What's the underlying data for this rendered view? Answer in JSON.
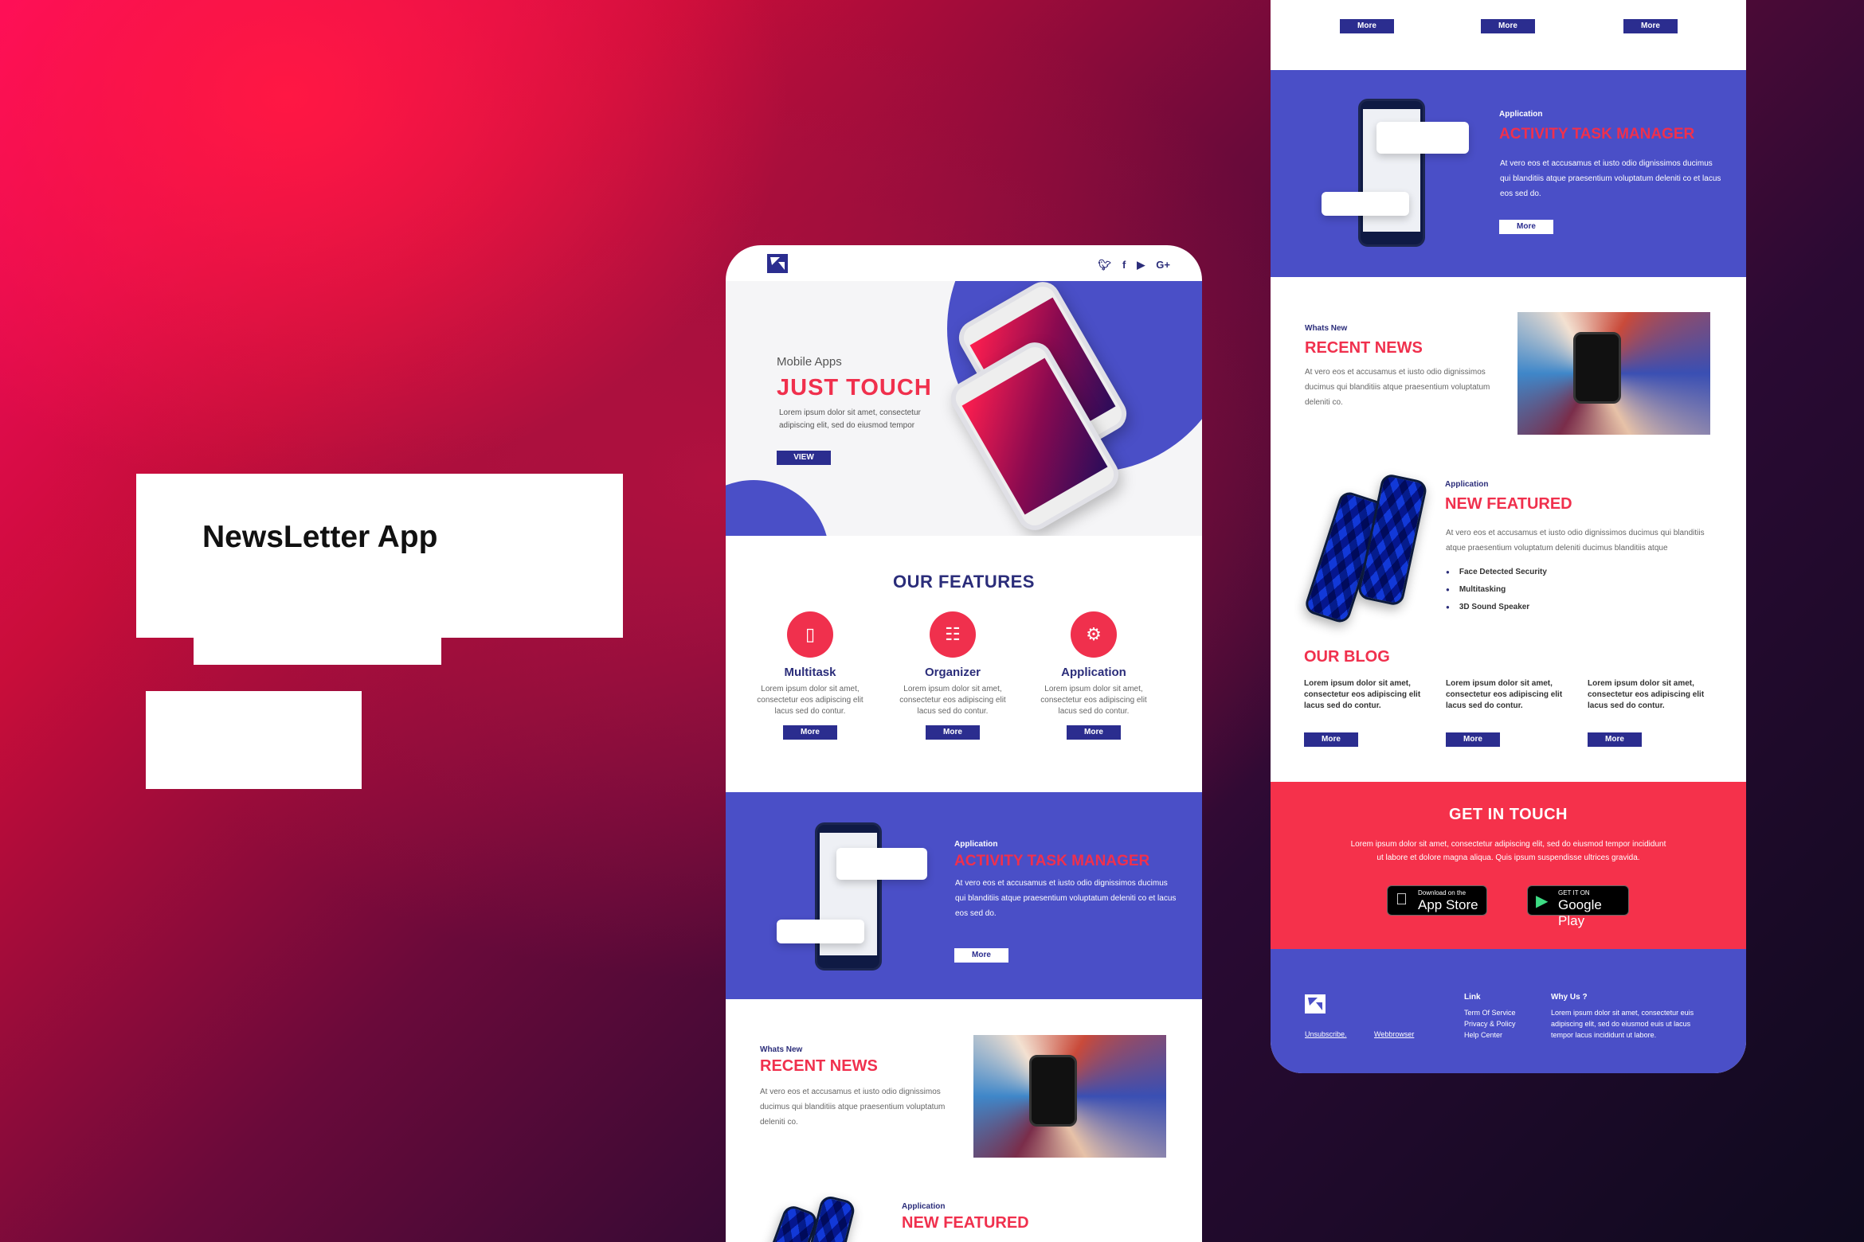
{
  "title_card": {
    "title": "NewsLetter App"
  },
  "phone": {
    "socials": [
      "y",
      "f",
      "▶",
      "G+"
    ],
    "hero": {
      "kicker": "Mobile Apps",
      "title": "JUST TOUCH",
      "text": "Lorem ipsum dolor sit amet, consectetur adipiscing elit, sed do eiusmod tempor",
      "button": "VIEW"
    },
    "features": {
      "title": "OUR FEATURES",
      "items": [
        {
          "icon": "phone-icon",
          "glyph": "▯",
          "title": "Multitask",
          "text": "Lorem ipsum dolor sit amet, consectetur eos adipiscing elit lacus sed do contur.",
          "button": "More"
        },
        {
          "icon": "inbox-icon",
          "glyph": "☷",
          "title": "Organizer",
          "text": "Lorem ipsum dolor sit amet, consectetur eos adipiscing elit lacus sed do contur.",
          "button": "More"
        },
        {
          "icon": "gears-icon",
          "glyph": "⚙",
          "title": "Application",
          "text": "Lorem ipsum dolor sit amet, consectetur eos adipiscing elit lacus sed do contur.",
          "button": "More"
        }
      ]
    },
    "atm": {
      "small": "Application",
      "title": "ACTIVITY TASK MANAGER",
      "text": "At vero eos et accusamus et iusto odio dignissimos ducimus qui blanditiis  atque praesentium voluptatum deleniti co et lacus eos sed do.",
      "button": "More"
    },
    "news": {
      "small": "Whats New",
      "title": "RECENT NEWS",
      "text": "At vero eos et accusamus et iusto odio dignissimos ducimus qui blanditiis atque praesentium voluptatum deleniti co."
    },
    "featured": {
      "small": "Application",
      "title": "NEW FEATURED"
    }
  },
  "panel": {
    "top_buttons": [
      "More",
      "More",
      "More"
    ],
    "atm": {
      "small": "Application",
      "title": "ACTIVITY TASK MANAGER",
      "text": "At vero eos et accusamus et iusto odio dignissimos ducimus qui blanditiis  atque praesentium voluptatum deleniti co et lacus eos sed do.",
      "button": "More"
    },
    "news": {
      "small": "Whats New",
      "title": "RECENT NEWS",
      "text": "At vero eos et accusamus et iusto odio dignissimos ducimus qui blanditiis atque praesentium voluptatum deleniti co."
    },
    "featured": {
      "small": "Application",
      "title": "NEW FEATURED",
      "text": "At vero eos et accusamus et iusto odio dignissimos ducimus qui blanditiis atque praesentium voluptatum deleniti ducimus blanditiis atque",
      "bullets": [
        "Face Detected Security",
        "Multitasking",
        "3D Sound Speaker"
      ]
    },
    "blog": {
      "title": "OUR BLOG",
      "posts": [
        {
          "text": "Lorem ipsum dolor sit amet, consectetur eos adipiscing elit lacus sed do contur.",
          "button": "More"
        },
        {
          "text": "Lorem ipsum dolor sit amet, consectetur eos adipiscing elit lacus sed do contur.",
          "button": "More"
        },
        {
          "text": "Lorem ipsum dolor sit amet, consectetur eos adipiscing elit lacus sed do contur.",
          "button": "More"
        }
      ]
    },
    "contact": {
      "title": "GET IN TOUCH",
      "text": "Lorem ipsum dolor sit amet, consectetur adipiscing elit, sed do eiusmod tempor incididunt ut labore et dolore magna aliqua. Quis ipsum suspendisse ultrices gravida.",
      "appstore_small": "Download on the",
      "appstore_big": "App Store",
      "gplay_small": "GET IT ON",
      "gplay_big": "Google Play"
    },
    "footer": {
      "unsubscribe": "Unsubscribe.",
      "webbrowser": "Webbrowser",
      "link_head": "Link",
      "links": [
        "Term Of Service",
        "Privacy & Policy",
        "Help Center"
      ],
      "why_head": "Why Us ?",
      "why_text": "Lorem ipsum dolor sit amet, consectetur euis adipiscing elit, sed do eiusmod euis ut lacus tempor lacus incididunt ut labore."
    }
  },
  "colors": {
    "accent_red": "#f0304d",
    "brand_blue": "#4a4fc7",
    "navy": "#2b2d7a"
  }
}
